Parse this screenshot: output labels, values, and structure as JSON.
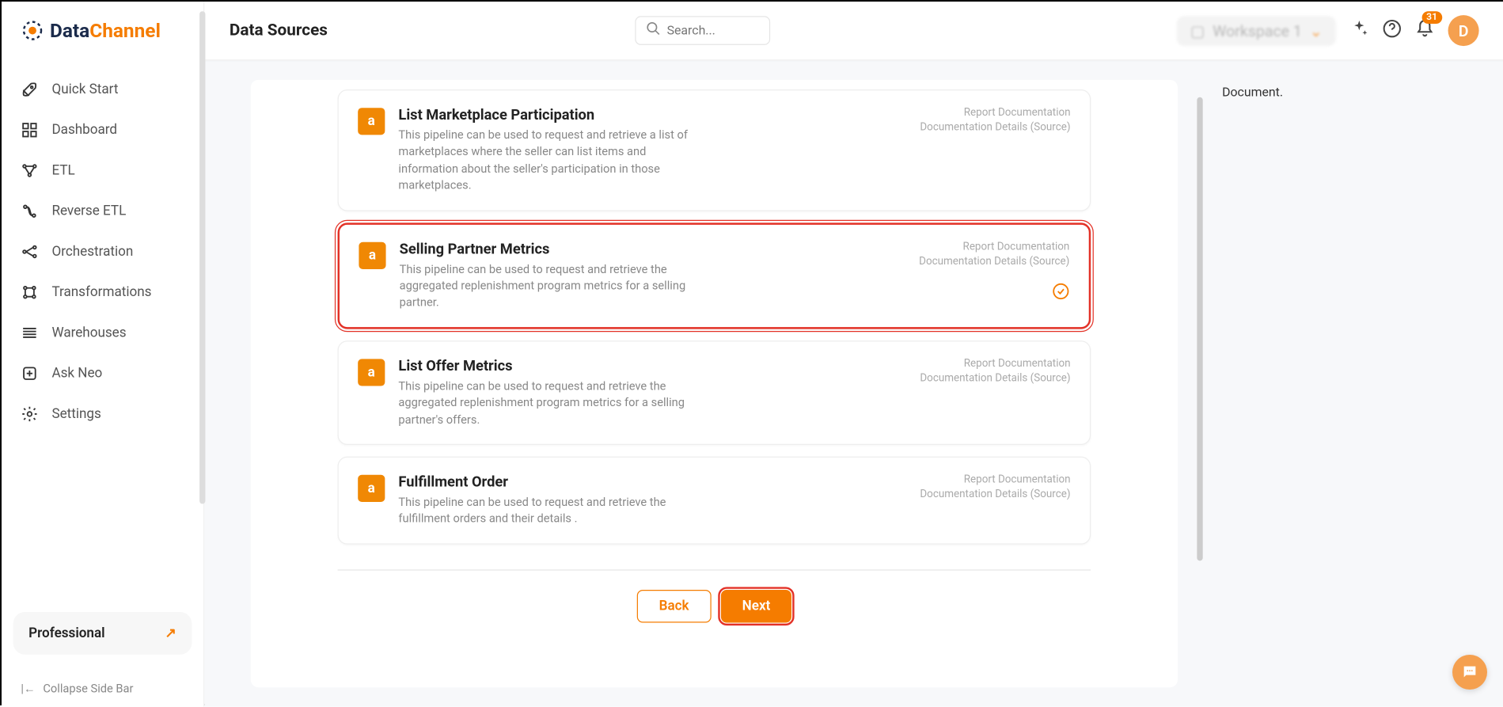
{
  "brand": {
    "dark": "Data",
    "orange": "Channel"
  },
  "sidebar": {
    "items": [
      {
        "label": "Quick Start"
      },
      {
        "label": "Dashboard"
      },
      {
        "label": "ETL"
      },
      {
        "label": "Reverse ETL"
      },
      {
        "label": "Orchestration"
      },
      {
        "label": "Transformations"
      },
      {
        "label": "Warehouses"
      },
      {
        "label": "Ask Neo"
      },
      {
        "label": "Settings"
      }
    ],
    "plan": "Professional",
    "collapse": "Collapse Side Bar"
  },
  "header": {
    "title": "Data Sources",
    "search_placeholder": "Search...",
    "workspace": "Workspace 1",
    "notifications": "31",
    "avatar": "D"
  },
  "right_panel": {
    "text": "Document."
  },
  "cards": [
    {
      "title": "List Marketplace Participation",
      "desc": "This pipeline can be used to request and retrieve a list of marketplaces where the seller can list items and information about the seller's participation in those marketplaces.",
      "link1": "Report Documentation",
      "link2": "Documentation Details (Source)",
      "selected": false
    },
    {
      "title": "Selling Partner Metrics",
      "desc": "This pipeline can be used to request and retrieve the aggregated replenishment program metrics for a selling partner.",
      "link1": "Report Documentation",
      "link2": "Documentation Details (Source)",
      "selected": true
    },
    {
      "title": "List Offer Metrics",
      "desc": "This pipeline can be used to request and retrieve the aggregated replenishment program metrics for a selling partner's offers.",
      "link1": "Report Documentation",
      "link2": "Documentation Details (Source)",
      "selected": false
    },
    {
      "title": "Fulfillment Order",
      "desc": "This pipeline can be used to request and retrieve the fulfillment orders and their details .",
      "link1": "Report Documentation",
      "link2": "Documentation Details (Source)",
      "selected": false
    }
  ],
  "buttons": {
    "back": "Back",
    "next": "Next"
  }
}
